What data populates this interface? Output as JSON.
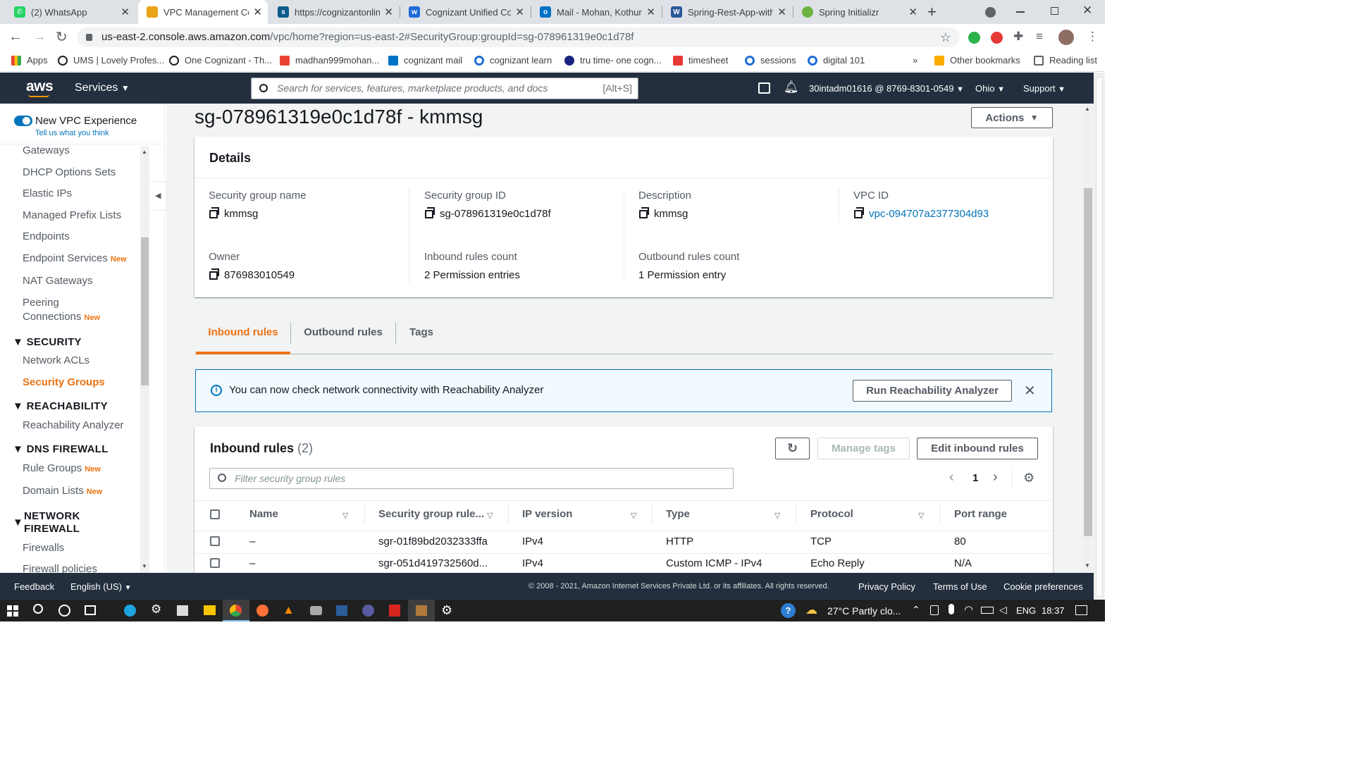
{
  "browser": {
    "tabs": [
      {
        "label": "(2) WhatsApp",
        "color": "#25d366",
        "glyph": "✆"
      },
      {
        "label": "VPC Management Co",
        "color": "#e8a317",
        "glyph": "■"
      },
      {
        "label": "https://cognizantonlin",
        "color": "#0a5b8a",
        "glyph": "s"
      },
      {
        "label": "Cognizant Unified Cor",
        "color": "#1f6dd8",
        "glyph": "w"
      },
      {
        "label": "Mail - Mohan, Kothur",
        "color": "#0072c6",
        "glyph": "o"
      },
      {
        "label": "Spring-Rest-App-with",
        "color": "#2b579a",
        "glyph": "W"
      },
      {
        "label": "Spring Initializr",
        "color": "#6db33f",
        "glyph": "◉"
      }
    ],
    "url_host": "us-east-2.console.aws.amazon.com",
    "url_path": "/vpc/home?region=us-east-2#SecurityGroup:groupId=sg-078961319e0c1d78f",
    "bookmarks": [
      {
        "label": "Apps",
        "color": "#ea4335"
      },
      {
        "label": "UMS | Lovely Profes...",
        "color": "#202124"
      },
      {
        "label": "One Cognizant - Th...",
        "color": "#202124"
      },
      {
        "label": "madhan999mohan...",
        "color": "#ea4335"
      },
      {
        "label": "cognizant mail",
        "color": "#0072c6"
      },
      {
        "label": "cognizant learn",
        "color": "#1f6dd8"
      },
      {
        "label": "tru time- one cogn...",
        "color": "#1a237e"
      },
      {
        "label": "timesheet",
        "color": "#e53935"
      },
      {
        "label": "sessions",
        "color": "#1f6dd8"
      },
      {
        "label": "digital 101",
        "color": "#1f6dd8"
      }
    ],
    "bm_more": "»",
    "other_bookmarks": "Other bookmarks",
    "reading_list": "Reading list"
  },
  "aws": {
    "logo": "aws",
    "services": "Services",
    "search_placeholder": "Search for services, features, marketplace products, and docs",
    "search_shortcut": "[Alt+S]",
    "account": "30intadm01616 @ 8769-8301-0549",
    "region": "Ohio",
    "support": "Support"
  },
  "sidebar": {
    "toggle_label": "New VPC Experience",
    "toggle_sub": "Tell us what you think",
    "new_badge": "New",
    "items": [
      {
        "label": "Gateways"
      },
      {
        "label": "DHCP Options Sets"
      },
      {
        "label": "Elastic IPs"
      },
      {
        "label": "Managed Prefix Lists"
      },
      {
        "label": "Endpoints"
      },
      {
        "label": "Endpoint Services"
      },
      {
        "label": "NAT Gateways"
      },
      {
        "label": "Peering"
      },
      {
        "label": "Connections"
      }
    ],
    "sec_security": "SECURITY",
    "nacl": "Network ACLs",
    "sg": "Security Groups",
    "sec_reach": "REACHABILITY",
    "reach": "Reachability Analyzer",
    "sec_dns": "DNS FIREWALL",
    "rule_groups": "Rule Groups",
    "domain_lists": "Domain Lists",
    "sec_nf1": "NETWORK",
    "sec_nf2": "FIREWALL",
    "firewalls": "Firewalls",
    "firewall_policies": "Firewall policies"
  },
  "page": {
    "title": "sg-078961319e0c1d78f - kmmsg",
    "actions": "Actions",
    "details_title": "Details",
    "fields": {
      "sg_name_label": "Security group name",
      "sg_name": "kmmsg",
      "sg_id_label": "Security group ID",
      "sg_id": "sg-078961319e0c1d78f",
      "desc_label": "Description",
      "desc": "kmmsg",
      "vpc_label": "VPC ID",
      "vpc": "vpc-094707a2377304d93",
      "owner_label": "Owner",
      "owner": "876983010549",
      "in_label": "Inbound rules count",
      "in": "2 Permission entries",
      "out_label": "Outbound rules count",
      "out": "1 Permission entry"
    },
    "tabs": {
      "inbound": "Inbound rules",
      "outbound": "Outbound rules",
      "tags": "Tags"
    },
    "banner": {
      "text": "You can now check network connectivity with Reachability Analyzer",
      "button": "Run Reachability Analyzer"
    },
    "rules": {
      "title": "Inbound rules",
      "count": "(2)",
      "manage_tags": "Manage tags",
      "edit": "Edit inbound rules",
      "filter_placeholder": "Filter security group rules",
      "page": "1",
      "columns": [
        "Name",
        "Security group rule...",
        "IP version",
        "Type",
        "Protocol",
        "Port range"
      ],
      "rows": [
        {
          "name": "–",
          "id": "sgr-01f89bd2032333ffa",
          "ip": "IPv4",
          "type": "HTTP",
          "protocol": "TCP",
          "port": "80"
        },
        {
          "name": "–",
          "id": "sgr-051d419732560d...",
          "ip": "IPv4",
          "type": "Custom ICMP - IPv4",
          "protocol": "Echo Reply",
          "port": "N/A"
        }
      ]
    }
  },
  "footer": {
    "feedback": "Feedback",
    "language": "English (US)",
    "copyright": "© 2008 - 2021, Amazon Internet Services Private Ltd. or its affiliates. All rights reserved.",
    "privacy": "Privacy Policy",
    "terms": "Terms of Use",
    "cookies": "Cookie preferences"
  },
  "taskbar": {
    "weather": "27°C  Partly clo...",
    "lang": "ENG",
    "time": "18:37"
  },
  "colors": {
    "aws_dark": "#232f3e",
    "accent": "#ec7211",
    "link": "#0073bb",
    "info_bg": "#f1faff"
  }
}
